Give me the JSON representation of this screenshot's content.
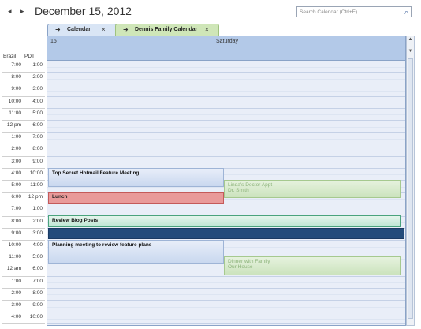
{
  "header": {
    "prev_arrow": "◂",
    "next_arrow": "▸",
    "date_title": "December 15, 2012",
    "search_placeholder": "Search Calendar (Ctrl+E)"
  },
  "tabs": [
    {
      "label": "Calendar",
      "close": "×",
      "arrow": "➜"
    },
    {
      "label": "Dennis Family Calendar",
      "close": "×",
      "arrow": "➜"
    }
  ],
  "timezones": {
    "left": "Brazil",
    "right": "PDT"
  },
  "time_rows": [
    {
      "brazil": "7:00",
      "pdt": "1:00"
    },
    {
      "brazil": "8:00",
      "pdt": "2:00"
    },
    {
      "brazil": "9:00",
      "pdt": "3:00"
    },
    {
      "brazil": "10:00",
      "pdt": "4:00"
    },
    {
      "brazil": "11:00",
      "pdt": "5:00"
    },
    {
      "brazil": "12 pm",
      "pdt": "6:00"
    },
    {
      "brazil": "1:00",
      "pdt": "7:00"
    },
    {
      "brazil": "2:00",
      "pdt": "8:00"
    },
    {
      "brazil": "3:00",
      "pdt": "9:00"
    },
    {
      "brazil": "4:00",
      "pdt": "10:00"
    },
    {
      "brazil": "5:00",
      "pdt": "11:00"
    },
    {
      "brazil": "6:00",
      "pdt": "12 pm"
    },
    {
      "brazil": "7:00",
      "pdt": "1:00"
    },
    {
      "brazil": "8:00",
      "pdt": "2:00"
    },
    {
      "brazil": "9:00",
      "pdt": "3:00"
    },
    {
      "brazil": "10:00",
      "pdt": "4:00"
    },
    {
      "brazil": "11:00",
      "pdt": "5:00"
    },
    {
      "brazil": "12 am",
      "pdt": "6:00"
    },
    {
      "brazil": "1:00",
      "pdt": "7:00"
    },
    {
      "brazil": "2:00",
      "pdt": "8:00"
    },
    {
      "brazil": "3:00",
      "pdt": "9:00"
    },
    {
      "brazil": "4:00",
      "pdt": "10:00"
    }
  ],
  "day": {
    "number": "15",
    "name": "Saturday"
  },
  "appointments": {
    "secret": "Top Secret Hotmail Feature Meeting",
    "doctor_title": "Linda's Doctor Appt",
    "doctor_sub": "Dr. Smith",
    "lunch": "Lunch",
    "blog": "Review Blog Posts",
    "planning": "Planning meeting to review feature plans",
    "dinner_title": "Dinner with Family",
    "dinner_sub": "Our House"
  },
  "colors": {
    "calendar_blue": "#c9d8ef",
    "family_green": "#cbe3bd",
    "lunch_red": "#e99a9a",
    "blog_teal": "#bfe6d4",
    "selected_navy": "#234b7b"
  }
}
